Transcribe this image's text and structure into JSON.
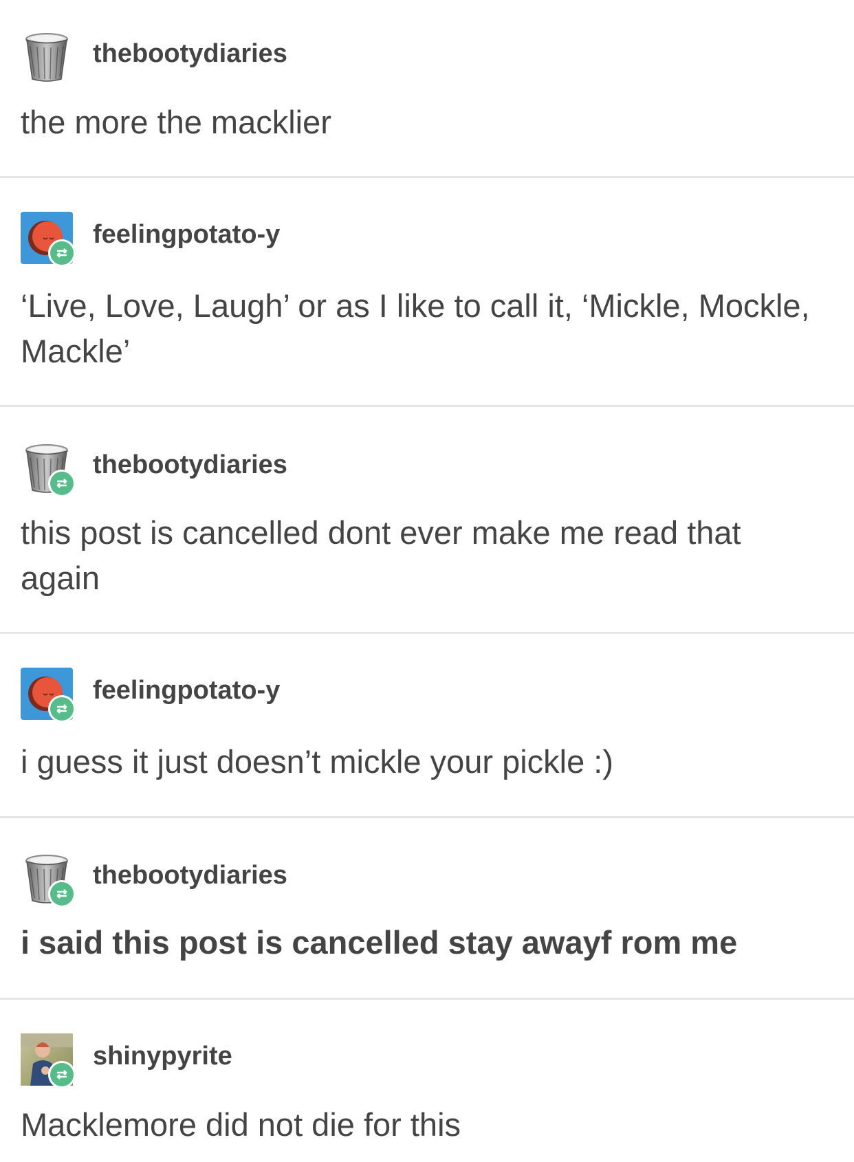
{
  "colors": {
    "text": "#444444",
    "divider": "#e6e6e6",
    "reblog_badge": "#56bc8a",
    "potato_avatar_bg": "#3d97d9",
    "potato_face": "#e8553a"
  },
  "posts": [
    {
      "username": "thebootydiaries",
      "avatar": "trash-can-icon",
      "reblog": false,
      "text": "the more the macklier",
      "bold": false
    },
    {
      "username": "feelingpotato-y",
      "avatar": "potato-face-icon",
      "reblog": true,
      "text": "‘Live, Love, Laugh’ or as I like to call it, ‘Mickle, Mockle, Mackle’",
      "bold": false
    },
    {
      "username": "thebootydiaries",
      "avatar": "trash-can-icon",
      "reblog": true,
      "text": "this post is cancelled dont ever make me read that again",
      "bold": false
    },
    {
      "username": "feelingpotato-y",
      "avatar": "potato-face-icon",
      "reblog": true,
      "text": "i guess it just doesn’t mickle your pickle :)",
      "bold": false
    },
    {
      "username": "thebootydiaries",
      "avatar": "trash-can-icon",
      "reblog": true,
      "text": "i said this post is cancelled stay awayf rom me",
      "bold": true
    },
    {
      "username": "shinypyrite",
      "avatar": "photo-avatar-icon",
      "reblog": true,
      "text": "Macklemore did not die for this",
      "bold": false
    }
  ]
}
